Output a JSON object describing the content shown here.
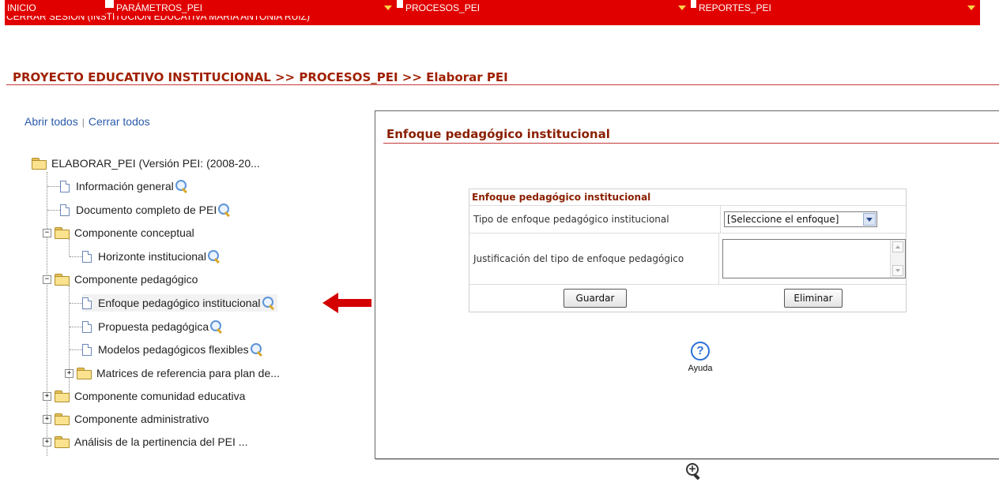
{
  "header": {
    "session_label": "CERRAR SESIÓN (INSTITUCION EDUCATIVA MARIA ANTONIA RUIZ)"
  },
  "nav": {
    "items": [
      {
        "label": "INICIO"
      },
      {
        "label": "PARÁMETROS_PEI"
      },
      {
        "label": "PROCESOS_PEI"
      },
      {
        "label": "REPORTES_PEI"
      }
    ]
  },
  "breadcrumb": "PROYECTO EDUCATIVO INSTITUCIONAL >> PROCESOS_PEI >> Elaborar PEI",
  "tree_controls": {
    "open_all": "Abrir todos",
    "separator": "|",
    "close_all": "Cerrar todos"
  },
  "tree": {
    "root": "ELABORAR_PEI (Versión PEI: (2008-20...",
    "items": [
      {
        "label": "Información general"
      },
      {
        "label": "Documento completo de PEI"
      },
      {
        "label": "Componente conceptual"
      },
      {
        "label": "Horizonte institucional"
      },
      {
        "label": "Componente pedagógico"
      },
      {
        "label": "Enfoque pedagógico institucional"
      },
      {
        "label": "Propuesta pedagógica"
      },
      {
        "label": "Modelos pedagógicos flexibles"
      },
      {
        "label": "Matrices de referencia para plan de..."
      },
      {
        "label": "Componente comunidad educativa"
      },
      {
        "label": "Componente administrativo"
      },
      {
        "label": "Análisis de la pertinencia del PEI ..."
      }
    ]
  },
  "panel": {
    "title": "Enfoque pedagógico institucional",
    "form": {
      "header": "Enfoque pedagógico institucional",
      "type_label": "Tipo de enfoque pedagógico institucional",
      "type_value": "[Seleccione el enfoque]",
      "justification_label": "Justificación del tipo de enfoque pedagógico",
      "justification_value": "",
      "save_label": "Guardar",
      "delete_label": "Eliminar"
    },
    "help_label": "Ayuda",
    "help_glyph": "?"
  },
  "icons": {
    "zoom": "zoom-in-icon",
    "magnifier": "magnifier-icon",
    "arrow": "red-arrow-icon"
  },
  "colors": {
    "primary": "#e00000",
    "heading": "#8a1f00",
    "link": "#2a5aa8"
  }
}
